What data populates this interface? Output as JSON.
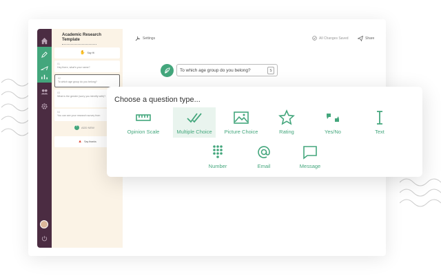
{
  "colors": {
    "accent": "#43a67c",
    "rail": "#4b2c42",
    "panel": "#fbf3e6"
  },
  "rail": {
    "items": [
      {
        "icon": "home-icon"
      },
      {
        "icon": "pencil-icon",
        "active": true
      },
      {
        "icon": "send-icon",
        "active": true
      },
      {
        "icon": "chart-icon",
        "active": true
      },
      {
        "icon": "users-icon"
      },
      {
        "icon": "gear-icon"
      }
    ],
    "bottom": [
      {
        "icon": "user-avatar"
      },
      {
        "icon": "power-icon"
      }
    ]
  },
  "template": {
    "title": "Academic Research Template"
  },
  "questions": [
    {
      "label": "Say Hi",
      "type": "welcome"
    },
    {
      "num": "01",
      "text": "Hey there, what's your name?"
    },
    {
      "num": "02",
      "text": "To which age group do you belong?",
      "active": true
    },
    {
      "num": "03",
      "text": "What is the gender (sorry you identify with)?"
    },
    {
      "num": "04",
      "text": "You can see your research survey from"
    }
  ],
  "add_new": "ADD NEW",
  "say_thanks": "Say thanks",
  "topbar": {
    "settings": "Settings",
    "saved": "All Changes Saved",
    "share": "Share"
  },
  "chat": {
    "question": "To which age group do you belong?",
    "tag": "S"
  },
  "overlay": {
    "title": "Choose a question type...",
    "types": [
      {
        "label": "Opinion Scale",
        "icon": "ruler-icon"
      },
      {
        "label": "Multiple Choice",
        "icon": "double-check-icon",
        "selected": true
      },
      {
        "label": "Picture Choice",
        "icon": "picture-icon"
      },
      {
        "label": "Rating",
        "icon": "star-icon"
      },
      {
        "label": "Yes/No",
        "icon": "yes-no-icon"
      },
      {
        "label": "Text",
        "icon": "text-cursor-icon"
      },
      {
        "label": "Number",
        "icon": "keypad-icon"
      },
      {
        "label": "Email",
        "icon": "at-icon"
      },
      {
        "label": "Message",
        "icon": "message-icon"
      }
    ]
  }
}
